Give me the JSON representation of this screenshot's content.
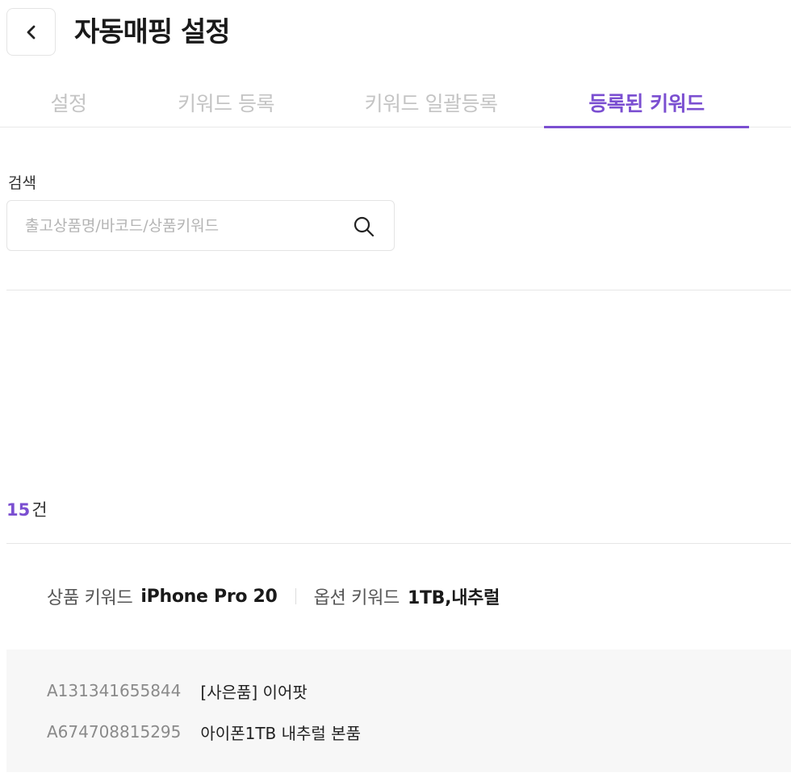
{
  "header": {
    "back_icon": "chevron-left-icon",
    "title": "자동매핑 설정"
  },
  "tabs": [
    {
      "label": "설정",
      "active": false
    },
    {
      "label": "키워드 등록",
      "active": false
    },
    {
      "label": "키워드 일괄등록",
      "active": false
    },
    {
      "label": "등록된 키워드",
      "active": true
    }
  ],
  "search": {
    "label": "검색",
    "placeholder": "출고상품명/바코드/상품키워드",
    "value": "",
    "icon": "search-icon"
  },
  "result": {
    "count": "15",
    "unit": "건"
  },
  "keyword_entry": {
    "product_label": "상품 키워드",
    "product_value": "iPhone Pro 20",
    "option_label": "옵션 키워드",
    "option_value": "1TB,내추럴",
    "mapped_items": [
      {
        "code": "A131341655844",
        "name": "[사은품] 이어팟"
      },
      {
        "code": "A674708815295",
        "name": "아이폰1TB 내추럴 본품"
      }
    ]
  },
  "colors": {
    "accent": "#7b4fd1",
    "inactive_tab": "#c4c4c4",
    "panel_bg": "#f7f7f7"
  }
}
